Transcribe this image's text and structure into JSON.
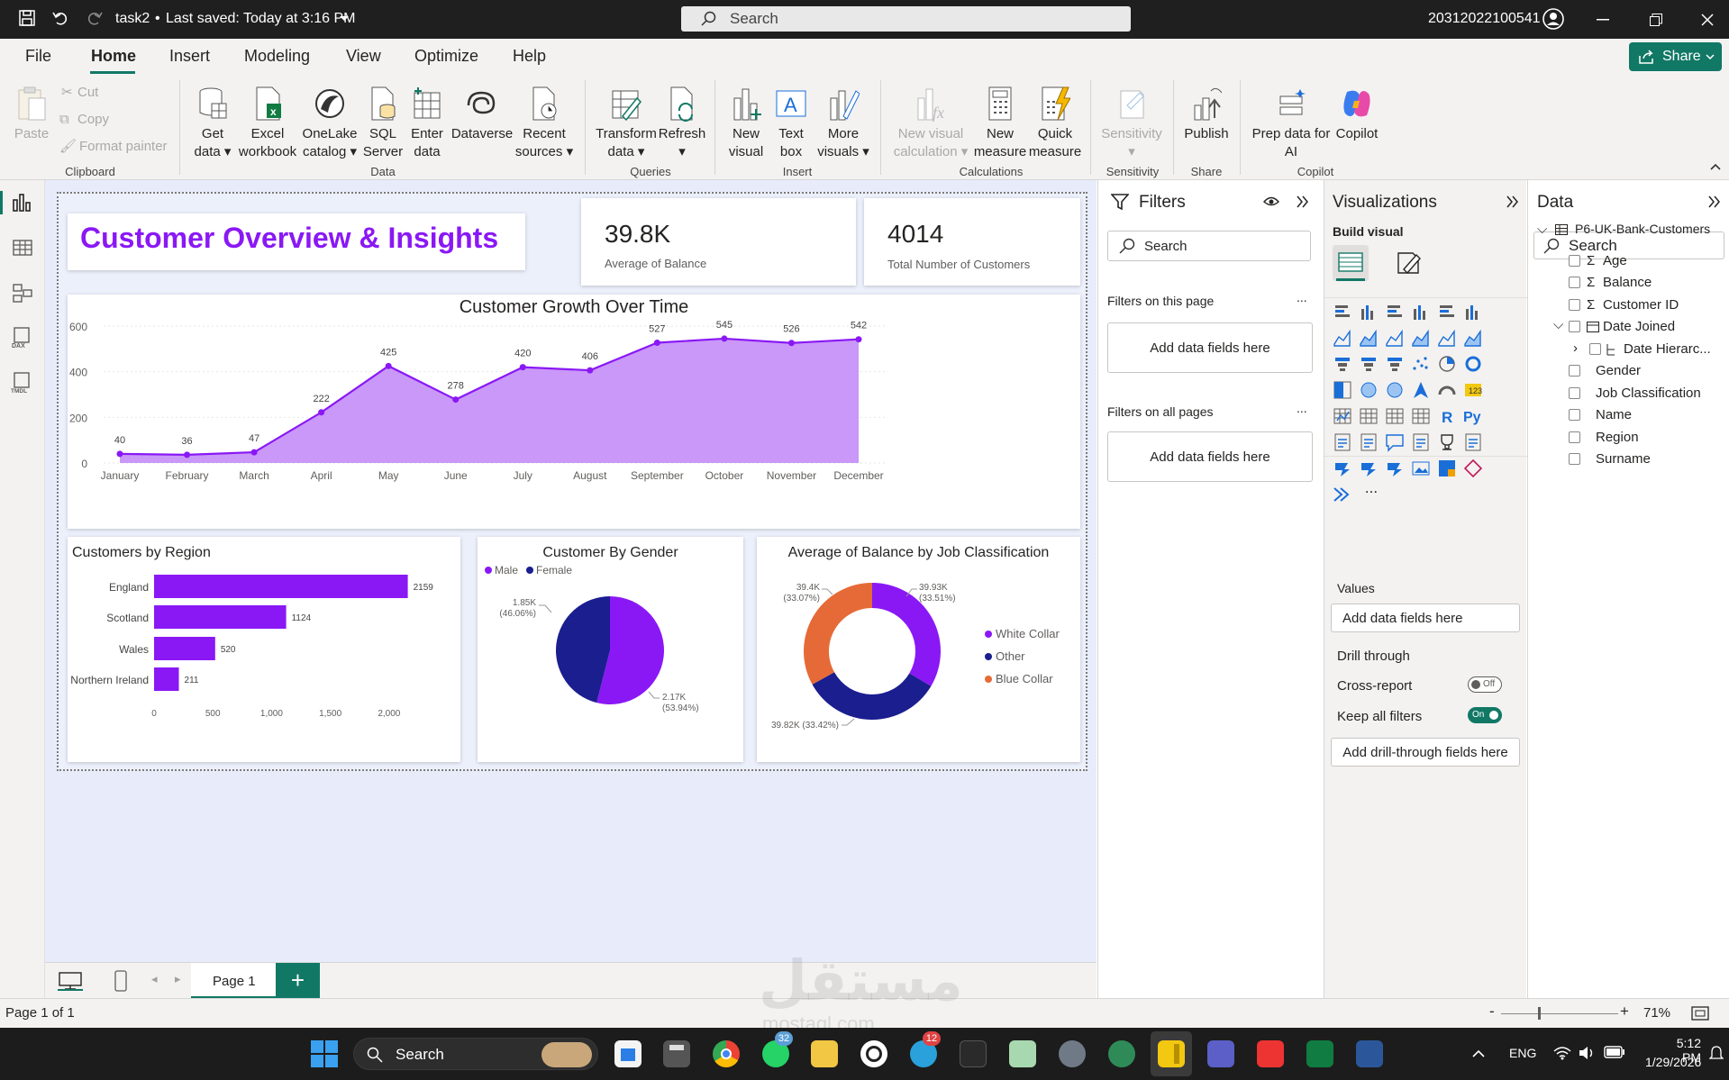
{
  "titlebar": {
    "doc_title": "task2",
    "separator": "•",
    "saved": "Last saved: Today at 3:16 PM",
    "search_placeholder": "Search",
    "user": "20312022100541"
  },
  "menu": {
    "items": [
      "File",
      "Home",
      "Insert",
      "Modeling",
      "View",
      "Optimize",
      "Help"
    ],
    "active": "Home",
    "share": "Share"
  },
  "ribbon": {
    "clipboard": {
      "paste": "Paste",
      "cut": "Cut",
      "copy": "Copy",
      "format_painter": "Format painter",
      "group": "Clipboard"
    },
    "data": {
      "get_data": [
        "Get",
        "data"
      ],
      "excel": [
        "Excel",
        "workbook"
      ],
      "onelake": [
        "OneLake",
        "catalog"
      ],
      "sql": [
        "SQL",
        "Server"
      ],
      "enter": [
        "Enter",
        "data"
      ],
      "dataverse": "Dataverse",
      "recent": [
        "Recent",
        "sources"
      ],
      "group": "Data"
    },
    "queries": {
      "transform": [
        "Transform",
        "data"
      ],
      "refresh": "Refresh",
      "group": "Queries"
    },
    "insert": {
      "new_visual": [
        "New",
        "visual"
      ],
      "text_box": [
        "Text",
        "box"
      ],
      "more_visuals": [
        "More",
        "visuals"
      ],
      "group": "Insert"
    },
    "calculations": {
      "new_visual_calc": [
        "New visual",
        "calculation"
      ],
      "new_measure": [
        "New",
        "measure"
      ],
      "quick_measure": [
        "Quick",
        "measure"
      ],
      "group": "Calculations"
    },
    "sensitivity": {
      "label": "Sensitivity",
      "group": "Sensitivity"
    },
    "share": {
      "publish": "Publish",
      "group": "Share"
    },
    "copilot": {
      "prep": [
        "Prep data for",
        "AI"
      ],
      "copilot": "Copilot",
      "group": "Copilot"
    }
  },
  "report": {
    "title": "Customer Overview & Insights",
    "kpis": [
      {
        "value": "39.8K",
        "label": "Average of Balance"
      },
      {
        "value": "4014",
        "label": "Total Number of Customers"
      }
    ]
  },
  "chart_data": [
    {
      "type": "area",
      "title": "Customer Growth Over Time",
      "categories": [
        "January",
        "February",
        "March",
        "April",
        "May",
        "June",
        "July",
        "August",
        "September",
        "October",
        "November",
        "December"
      ],
      "values": [
        40,
        36,
        47,
        222,
        425,
        278,
        420,
        406,
        527,
        545,
        526,
        542
      ],
      "ylim": [
        0,
        600
      ],
      "yticks": [
        "0",
        "200",
        "400",
        "600"
      ],
      "color": "#8a18f5",
      "fill": "#c48df7",
      "grid": true
    },
    {
      "type": "bar",
      "orientation": "horizontal",
      "title": "Customers by Region",
      "categories": [
        "England",
        "Scotland",
        "Wales",
        "Northern Ireland"
      ],
      "values": [
        2159,
        1124,
        520,
        211
      ],
      "xlim": [
        0,
        2300
      ],
      "xticks": [
        "0",
        "500",
        "1,000",
        "1,500",
        "2,000"
      ],
      "color": "#8a18f5"
    },
    {
      "type": "pie",
      "title": "Customer By Gender",
      "legend": [
        "Male",
        "Female"
      ],
      "slices": [
        {
          "name": "Male",
          "value": 2170,
          "label": "2.17K",
          "pct": "(53.94%)",
          "color": "#8a18f5"
        },
        {
          "name": "Female",
          "value": 1850,
          "label": "1.85K",
          "pct": "(46.06%)",
          "color": "#1a1e8f"
        }
      ]
    },
    {
      "type": "donut",
      "title": "Average of Balance by Job Classification",
      "legend": [
        "White Collar",
        "Other",
        "Blue Collar"
      ],
      "slices": [
        {
          "name": "White Collar",
          "value": 39930,
          "label": "39.93K",
          "pct": "(33.51%)",
          "color": "#8a18f5"
        },
        {
          "name": "Other",
          "value": 39820,
          "label": "39.82K",
          "pct": "(33.42%)",
          "color": "#1a1e8f"
        },
        {
          "name": "Blue Collar",
          "value": 39400,
          "label": "39.4K",
          "pct": "(33.07%)",
          "color": "#e66a37"
        }
      ]
    }
  ],
  "filters": {
    "title": "Filters",
    "search": "Search",
    "this_page": "Filters on this page",
    "all_pages": "Filters on all pages",
    "add": "Add data fields here",
    "more": "..."
  },
  "visualizations": {
    "title": "Visualizations",
    "build": "Build visual",
    "values": "Values",
    "add_fields": "Add data fields here",
    "drill": "Drill through",
    "cross_report": "Cross-report",
    "cross_state": "Off",
    "keep_filters": "Keep all filters",
    "keep_state": "On",
    "add_drill": "Add drill-through fields here",
    "more": "..."
  },
  "data_pane": {
    "title": "Data",
    "search": "Search",
    "table": "P6-UK-Bank-Customers",
    "fields": [
      {
        "name": "Age",
        "sigma": true
      },
      {
        "name": "Balance",
        "sigma": true
      },
      {
        "name": "Customer ID",
        "sigma": true
      },
      {
        "name": "Date Joined",
        "sigma": false
      },
      {
        "name": "Date Hierarc...",
        "sigma": false
      },
      {
        "name": "Gender",
        "sigma": false
      },
      {
        "name": "Job Classification",
        "sigma": false
      },
      {
        "name": "Name",
        "sigma": false
      },
      {
        "name": "Region",
        "sigma": false
      },
      {
        "name": "Surname",
        "sigma": false
      }
    ]
  },
  "pages": {
    "tab": "Page 1",
    "add": "+"
  },
  "status": {
    "page": "Page 1 of 1",
    "zoom": "71%",
    "minus": "-",
    "plus": "+"
  },
  "taskbar": {
    "search": "Search",
    "lang": "ENG",
    "time": "5:12 PM",
    "date": "1/29/2026",
    "badge_whatsapp": "32",
    "badge_telegram": "12"
  },
  "watermark": {
    "arabic": "مستقل",
    "latin": "mostaql.com"
  }
}
